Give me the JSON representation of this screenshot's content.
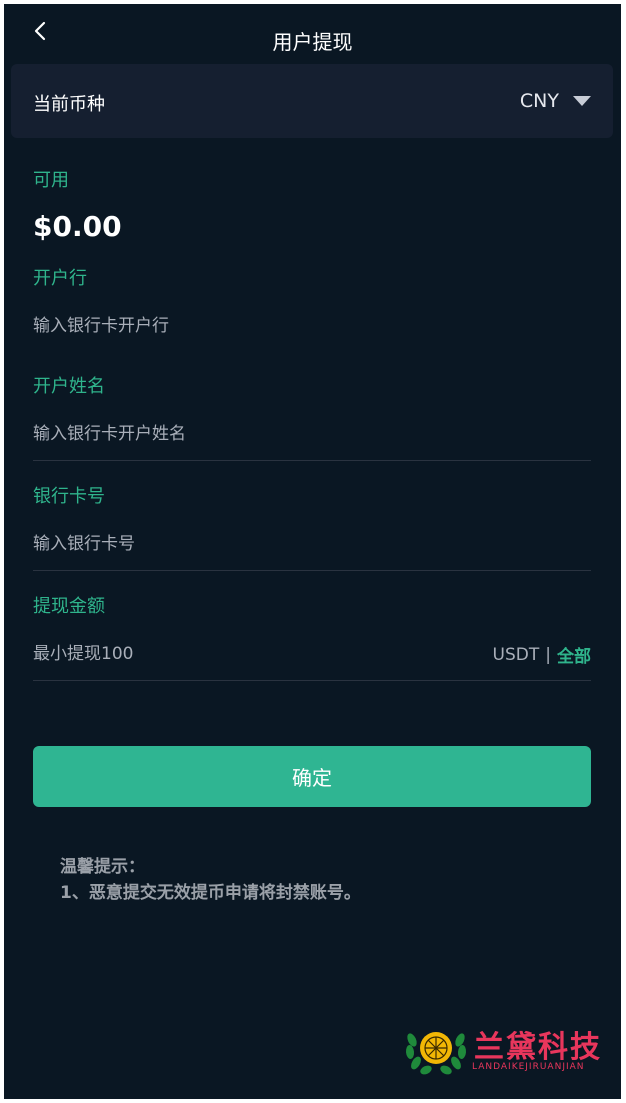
{
  "header": {
    "title": "用户提现",
    "back_icon": "chevron-left-icon"
  },
  "currency": {
    "label": "当前币种",
    "value": "CNY"
  },
  "balance": {
    "label": "可用",
    "amount": "$0.00"
  },
  "form": {
    "bank": {
      "label": "开户行",
      "placeholder": "输入银行卡开户行"
    },
    "name": {
      "label": "开户姓名",
      "placeholder": "输入银行卡开户姓名"
    },
    "card": {
      "label": "银行卡号",
      "placeholder": "输入银行卡号"
    },
    "amount": {
      "label": "提现金额",
      "placeholder": "最小提现100",
      "unit": "USDT",
      "separator": "|",
      "all_label": "全部"
    }
  },
  "confirm_label": "确定",
  "tips": {
    "title": "温馨提示：",
    "line1": "1、恶意提交无效提币申请将封禁账号。"
  },
  "watermark": {
    "name": "兰黛科技",
    "sub": "LANDAIKEJIRUANJIAN"
  },
  "colors": {
    "background": "#0a1723",
    "accent": "#2fb48c",
    "button": "#2fb592",
    "watermark": "#e8365c"
  }
}
